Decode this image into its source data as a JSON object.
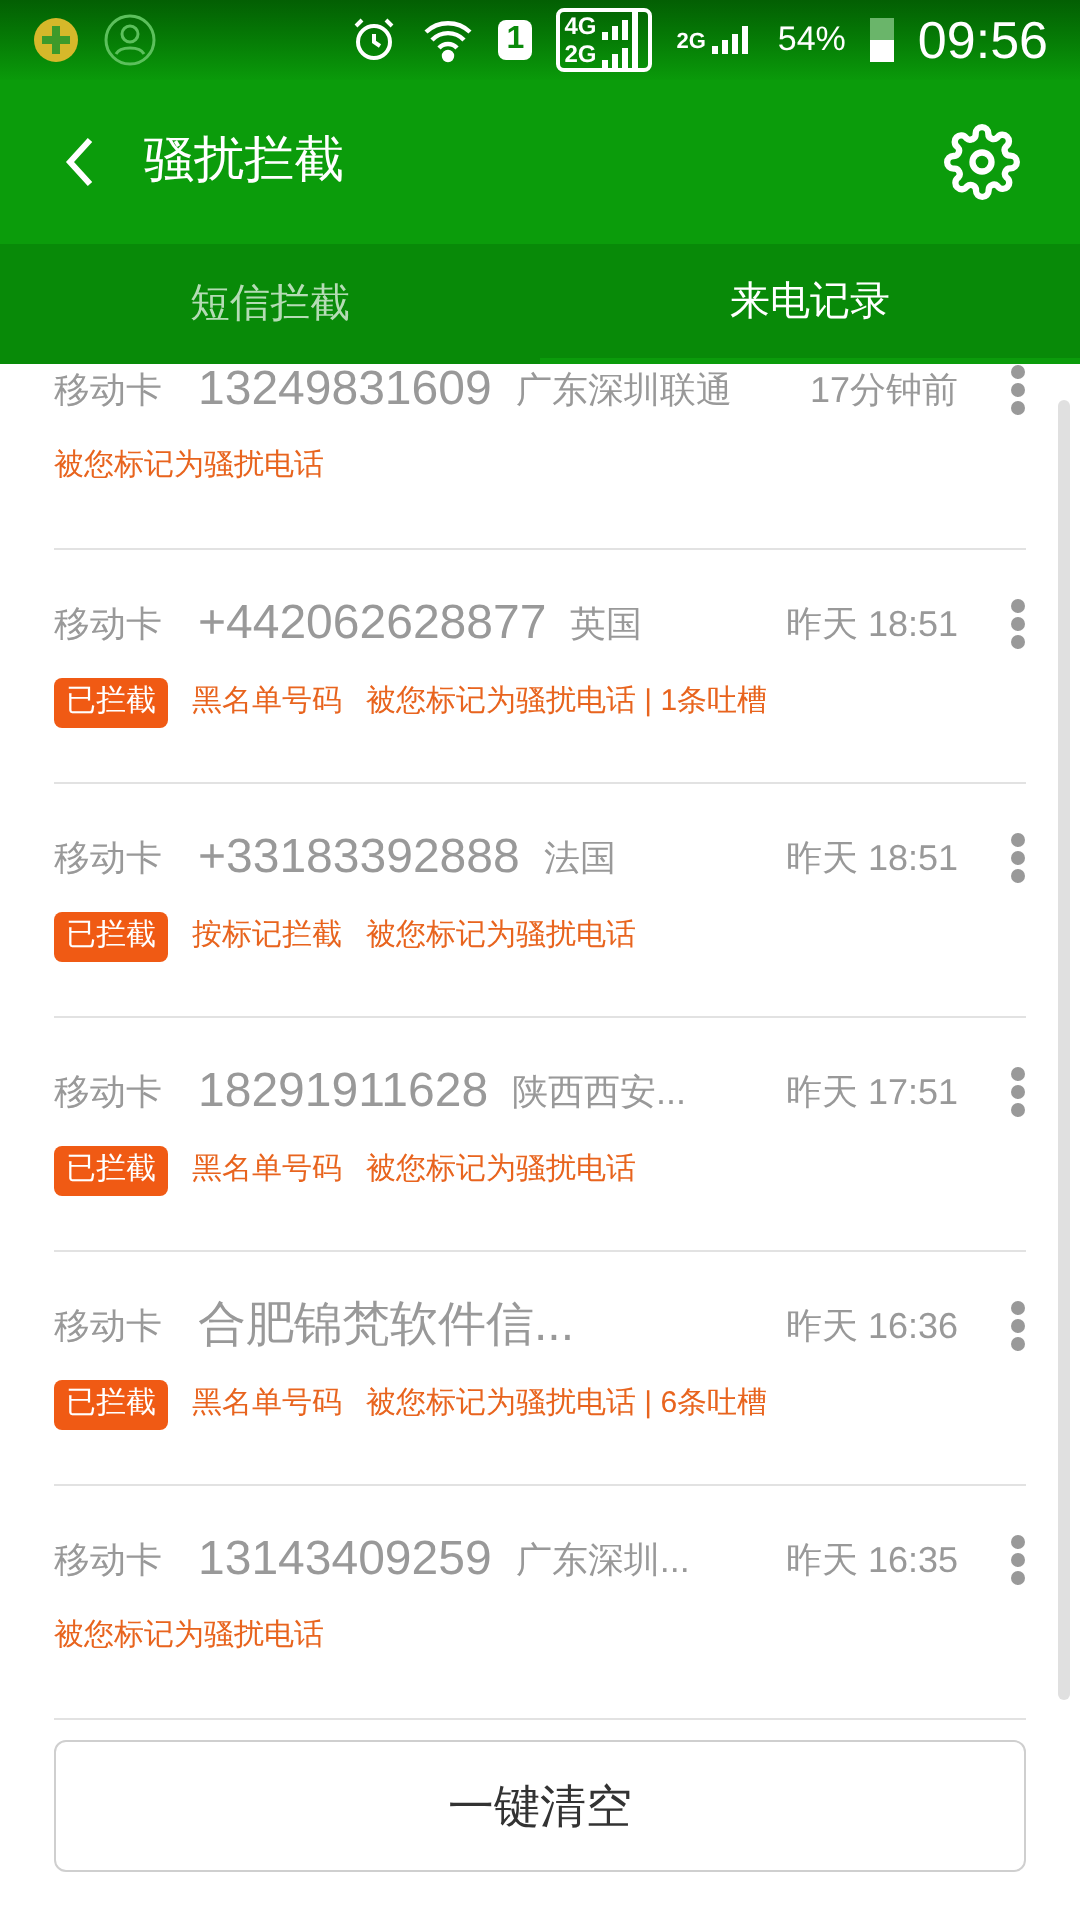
{
  "status_bar": {
    "sim_slot": "1",
    "network_top": "4G",
    "network_bottom": "2G",
    "network_second": "2G",
    "battery": "54%",
    "time": "09:56"
  },
  "header": {
    "title": "骚扰拦截"
  },
  "tabs": [
    {
      "label": "短信拦截",
      "selected": false
    },
    {
      "label": "来电记录",
      "selected": true
    }
  ],
  "calls": [
    {
      "card": "移动卡",
      "number": "13249831609",
      "location": "广东深圳联通",
      "time": "17分钟前",
      "blocked": false,
      "tags": [
        "被您标记为骚扰电话"
      ]
    },
    {
      "card": "移动卡",
      "number": "+442062628877",
      "location": "英国",
      "time": "昨天 18:51",
      "blocked": true,
      "badge": "已拦截",
      "tags": [
        "黑名单号码",
        "被您标记为骚扰电话 | 1条吐槽"
      ]
    },
    {
      "card": "移动卡",
      "number": "+33183392888",
      "location": "法国",
      "time": "昨天 18:51",
      "blocked": true,
      "badge": "已拦截",
      "tags": [
        "按标记拦截",
        "被您标记为骚扰电话"
      ]
    },
    {
      "card": "移动卡",
      "number": "18291911628",
      "location": "陕西西安...",
      "time": "昨天 17:51",
      "blocked": true,
      "badge": "已拦截",
      "tags": [
        "黑名单号码",
        "被您标记为骚扰电话"
      ]
    },
    {
      "card": "移动卡",
      "number": "合肥锦梵软件信...",
      "time": "昨天 16:36",
      "blocked": true,
      "badge": "已拦截",
      "tags": [
        "黑名单号码",
        "被您标记为骚扰电话 | 6条吐槽"
      ]
    },
    {
      "card": "移动卡",
      "number": "13143409259",
      "location": "广东深圳...",
      "time": "昨天 16:35",
      "blocked": false,
      "tags": [
        "被您标记为骚扰电话"
      ]
    }
  ],
  "clear_button": "一键清空"
}
